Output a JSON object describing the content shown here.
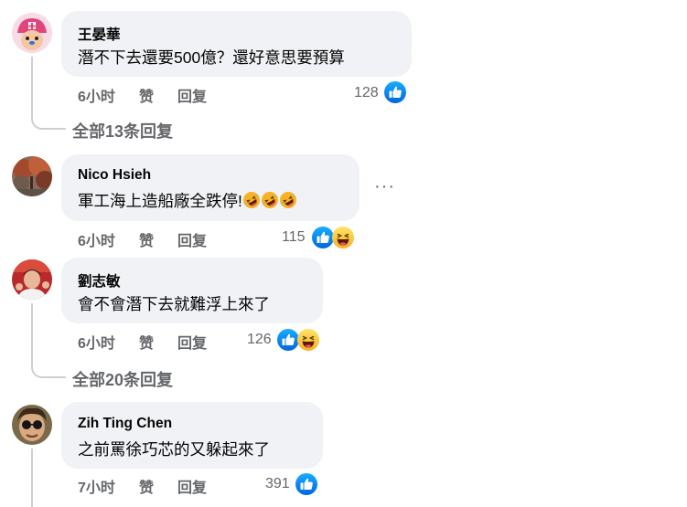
{
  "comments": [
    {
      "author": "王晏華",
      "text": "潛不下去還要500億？還好意思要預算",
      "time": "6小时",
      "like_label": "赞",
      "reply_label": "回复",
      "reaction_count": "128",
      "reactions": [
        "like-icon"
      ]
    },
    {
      "author": "Nico Hsieh",
      "text": "軍工海上造船廠全跌停!",
      "text_emojis": [
        "rolling-laughing-emoji",
        "rolling-laughing-emoji",
        "rolling-laughing-emoji"
      ],
      "time": "6小时",
      "like_label": "赞",
      "reply_label": "回复",
      "reaction_count": "115",
      "reactions": [
        "like-icon",
        "haha-icon"
      ]
    },
    {
      "author": "劉志敏",
      "text": "會不會潛下去就難浮上來了",
      "time": "6小时",
      "like_label": "赞",
      "reply_label": "回复",
      "reaction_count": "126",
      "reactions": [
        "like-icon",
        "haha-icon"
      ]
    },
    {
      "author": "Zih Ting Chen",
      "text": "之前罵徐巧芯的又躲起來了",
      "time": "7小时",
      "like_label": "赞",
      "reply_label": "回复",
      "reaction_count": "391",
      "reactions": [
        "like-icon"
      ]
    }
  ],
  "view_replies": [
    {
      "label": "全部13条回复"
    },
    {
      "label": "全部20条回复"
    }
  ],
  "more_options": "···",
  "colors": {
    "bubble": "#f0f2f5",
    "secondary_text": "#65676b",
    "like_blue": "#1877f2",
    "thread_line": "#ccd0d5",
    "haha_yellow": "#f7b125"
  }
}
